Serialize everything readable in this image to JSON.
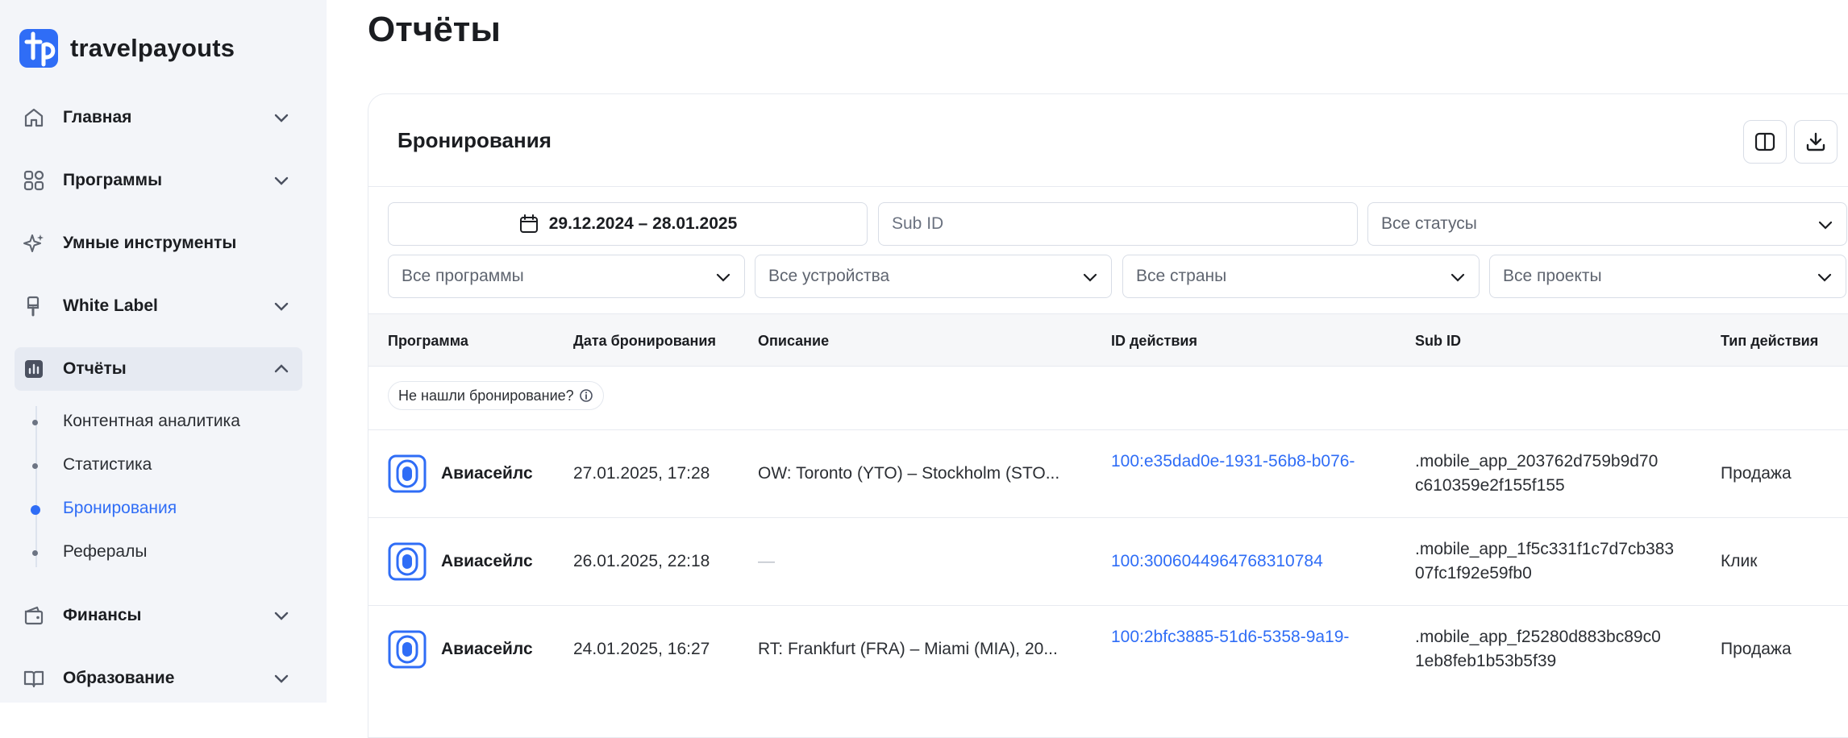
{
  "app": {
    "name": "travelpayouts"
  },
  "nav": {
    "items": [
      {
        "label": "Главная",
        "icon": "home-icon"
      },
      {
        "label": "Программы",
        "icon": "grid-icon"
      },
      {
        "label": "Умные инструменты",
        "icon": "sparkle-icon"
      },
      {
        "label": "White Label",
        "icon": "brush-icon"
      },
      {
        "label": "Отчёты",
        "icon": "chart-icon"
      },
      {
        "label": "Финансы",
        "icon": "wallet-icon"
      },
      {
        "label": "Образование",
        "icon": "book-icon"
      }
    ],
    "reports_sub": [
      {
        "label": "Контентная аналитика"
      },
      {
        "label": "Статистика"
      },
      {
        "label": "Бронирования"
      },
      {
        "label": "Рефералы"
      }
    ]
  },
  "page": {
    "title": "Отчёты"
  },
  "card": {
    "title": "Бронирования"
  },
  "filters": {
    "date_range": "29.12.2024 – 28.01.2025",
    "subid_placeholder": "Sub ID",
    "status": "Все статусы",
    "programs": "Все программы",
    "devices": "Все устройства",
    "countries": "Все страны",
    "projects": "Все проекты"
  },
  "table": {
    "columns": [
      "Программа",
      "Дата бронирования",
      "Описание",
      "ID действия",
      "Sub ID",
      "Тип действия"
    ],
    "notfound_label": "Не нашли бронирование?",
    "rows": [
      {
        "program": "Авиасейлс",
        "date": "27.01.2025, 17:28",
        "description": "OW: Toronto (YTO) – Stockholm (STO...",
        "action_id": "100:e35dad0e-1931-56b8-b076-",
        "sub_id_1": ".mobile_app_203762d759b9d70",
        "sub_id_2": "c610359e2f155f155",
        "type": "Продажа"
      },
      {
        "program": "Авиасейлс",
        "date": "26.01.2025, 22:18",
        "description": "—",
        "action_id": "100:3006044964768310784",
        "sub_id_1": ".mobile_app_1f5c331f1c7d7cb383",
        "sub_id_2": "07fc1f92e59fb0",
        "type": "Клик"
      },
      {
        "program": "Авиасейлс",
        "date": "24.01.2025, 16:27",
        "description": "RT: Frankfurt (FRA) – Miami (MIA), 20...",
        "action_id": "100:2bfc3885-51d6-5358-9a19-",
        "sub_id_1": ".mobile_app_f25280d883bc89c0",
        "sub_id_2": "1eb8feb1b53b5f39",
        "type": "Продажа"
      }
    ]
  },
  "colors": {
    "accent": "#2f6df6",
    "sidebar_bg": "#f3f5f9",
    "active_bg": "#e6eaf2"
  }
}
